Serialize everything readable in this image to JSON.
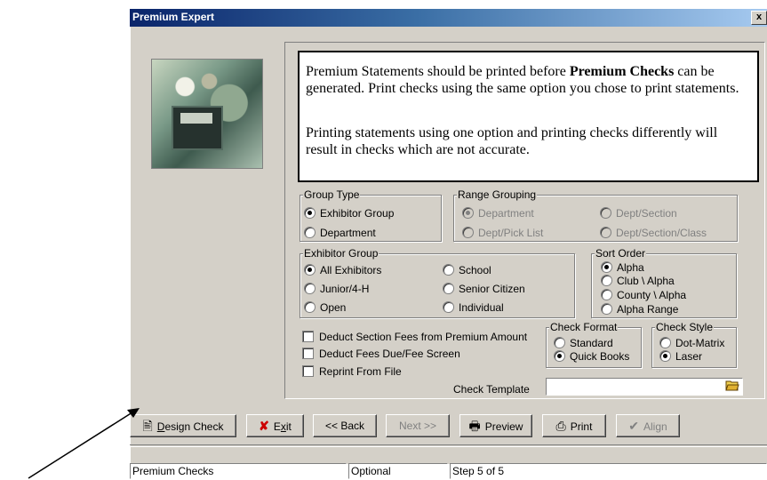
{
  "window": {
    "title": "Premium Expert",
    "close_glyph": "x"
  },
  "message": {
    "p1_a": "Premium Statements should be printed before ",
    "p1_b": "Premium Checks",
    "p1_c": " can be generated. Print checks using the same option you chose to print statements.",
    "p2": "Printing statements using one option and printing checks differently will result in checks which are not accurate."
  },
  "group_type": {
    "label": "Group Type",
    "options": [
      "Exhibitor Group",
      "Department"
    ],
    "selected": "Exhibitor Group"
  },
  "range_grouping": {
    "label": "Range Grouping",
    "options": [
      "Department",
      "Dept/Section",
      "Dept/Pick List",
      "Dept/Section/Class"
    ],
    "selected": "Department",
    "enabled": false
  },
  "exhibitor_group": {
    "label": "Exhibitor Group",
    "options": [
      "All Exhibitors",
      "School",
      "Junior/4-H",
      "Senior Citizen",
      "Open",
      "Individual"
    ],
    "selected": "All Exhibitors"
  },
  "sort_order": {
    "label": "Sort Order",
    "options": [
      "Alpha",
      "Club \\ Alpha",
      "County \\ Alpha",
      "Alpha Range"
    ],
    "selected": "Alpha"
  },
  "checkboxes": [
    "Deduct Section Fees from Premium Amount",
    "Deduct Fees Due/Fee Screen",
    "Reprint From File"
  ],
  "check_format": {
    "label": "Check Format",
    "options": [
      "Standard",
      "Quick Books"
    ],
    "selected": "Quick Books"
  },
  "check_style": {
    "label": "Check Style",
    "options": [
      "Dot-Matrix",
      "Laser"
    ],
    "selected": "Laser"
  },
  "check_template": {
    "label": "Check Template",
    "value": ""
  },
  "buttons": {
    "design_check": {
      "pre": "",
      "u": "D",
      "post": "esign Check"
    },
    "exit": {
      "pre": "E",
      "u": "x",
      "post": "it"
    },
    "back": "<< Back",
    "next": "Next >>",
    "preview": "Preview",
    "print": "Print",
    "align": "Align"
  },
  "status": {
    "left": "Premium Checks",
    "middle": "Optional",
    "right": "Step 5 of 5"
  },
  "colors": {
    "face": "#d4d0c8",
    "title_start": "#0a246a",
    "title_end": "#a6caf0",
    "exit_x": "#cc0000"
  }
}
